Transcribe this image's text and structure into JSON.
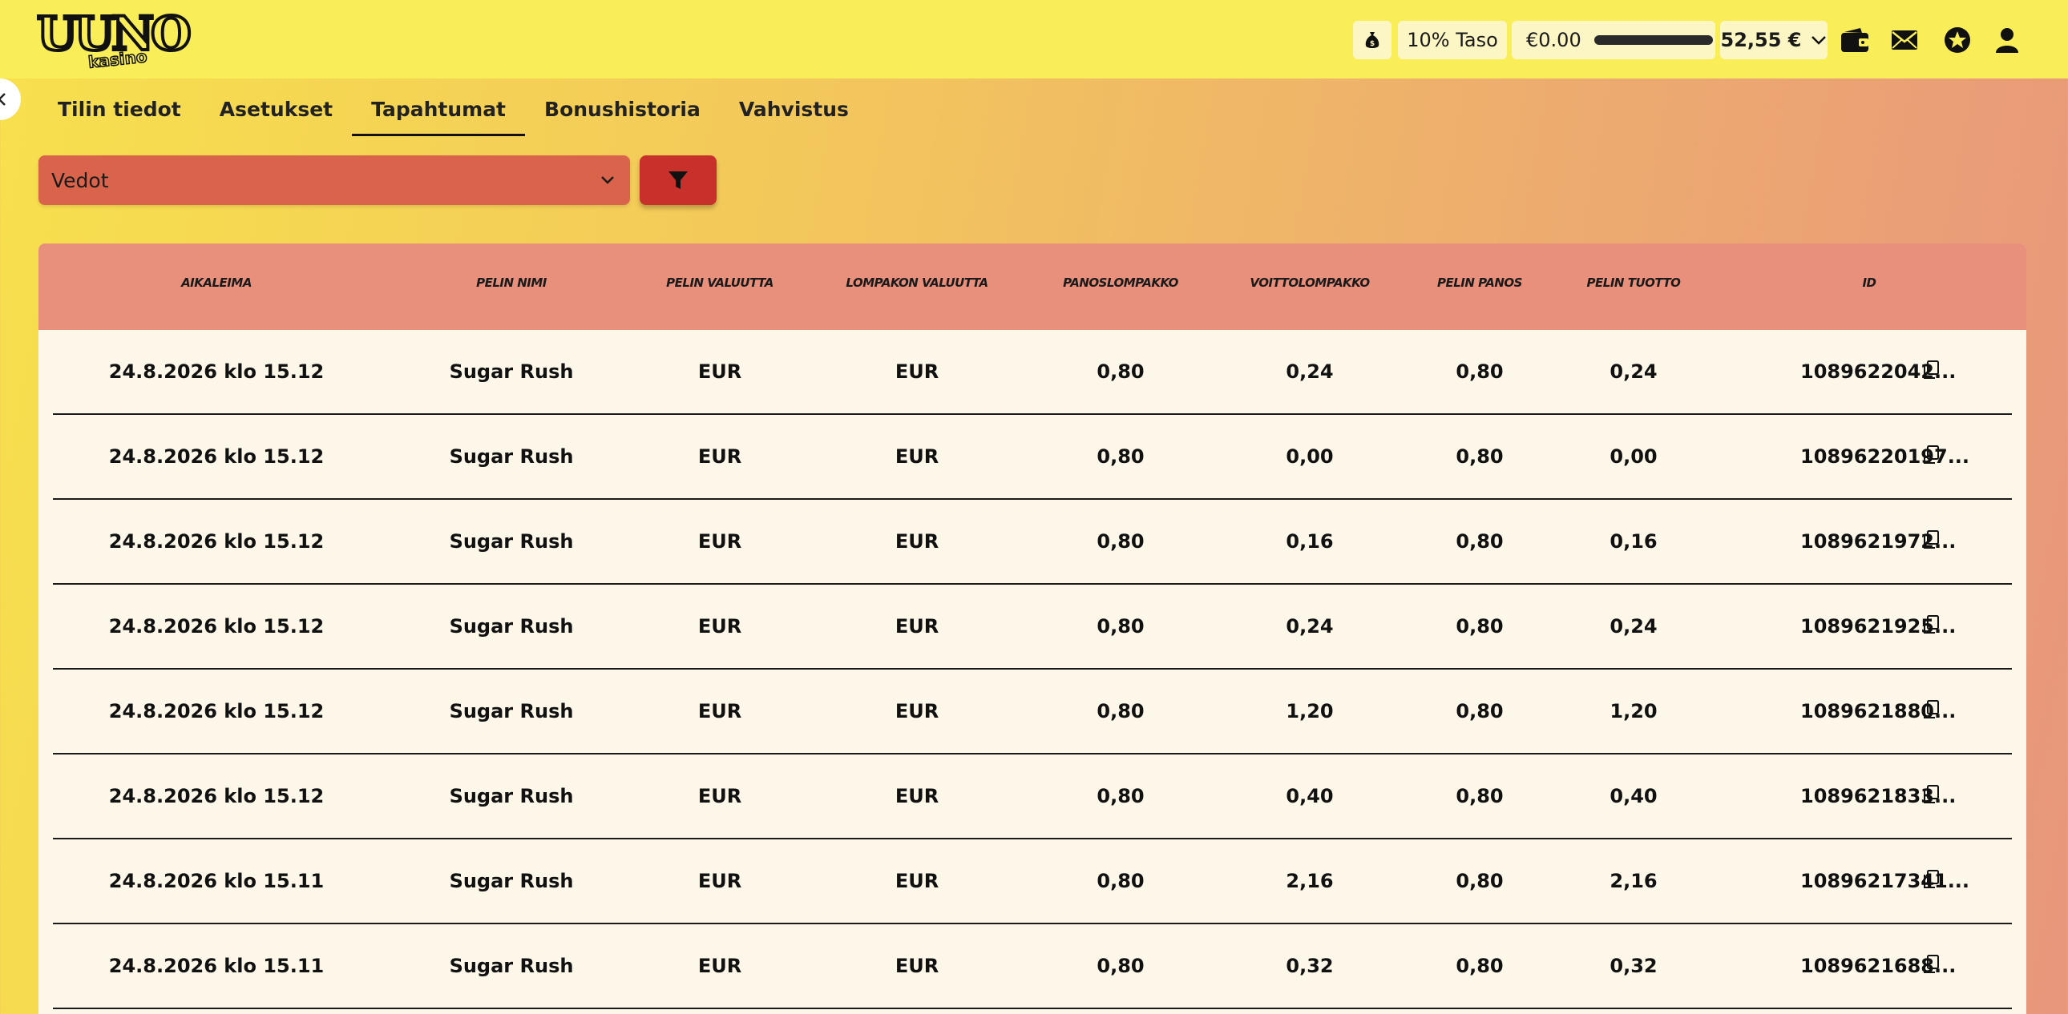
{
  "header": {
    "logo_main": "UUNO",
    "logo_sub": "kasino",
    "level_label": "10% Taso",
    "progress_amount": "€0.00",
    "progress_fraction": 0.0,
    "balance": "52,55 €",
    "icons": [
      "money-bag-icon",
      "wallet-icon",
      "mail-icon",
      "star-icon",
      "user-icon"
    ]
  },
  "tabs": [
    {
      "label": "Tilin tiedot",
      "active": false
    },
    {
      "label": "Asetukset",
      "active": false
    },
    {
      "label": "Tapahtumat",
      "active": true
    },
    {
      "label": "Bonushistoria",
      "active": false
    },
    {
      "label": "Vahvistus",
      "active": false
    }
  ],
  "filter": {
    "selected": "Vedot"
  },
  "table": {
    "columns": [
      "Aikaleima",
      "Pelin nimi",
      "Pelin valuutta",
      "Lompakon valuutta",
      "Panoslompakko",
      "Voittolompakko",
      "Pelin panos",
      "Pelin tuotto",
      "ID"
    ],
    "rows": [
      [
        "24.8.2026 klo 15.12",
        "Sugar Rush",
        "EUR",
        "EUR",
        "0,80",
        "0,24",
        "0,80",
        "0,24",
        "1089622042..."
      ],
      [
        "24.8.2026 klo 15.12",
        "Sugar Rush",
        "EUR",
        "EUR",
        "0,80",
        "0,00",
        "0,80",
        "0,00",
        "10896220197..."
      ],
      [
        "24.8.2026 klo 15.12",
        "Sugar Rush",
        "EUR",
        "EUR",
        "0,80",
        "0,16",
        "0,80",
        "0,16",
        "1089621972..."
      ],
      [
        "24.8.2026 klo 15.12",
        "Sugar Rush",
        "EUR",
        "EUR",
        "0,80",
        "0,24",
        "0,80",
        "0,24",
        "1089621925..."
      ],
      [
        "24.8.2026 klo 15.12",
        "Sugar Rush",
        "EUR",
        "EUR",
        "0,80",
        "1,20",
        "0,80",
        "1,20",
        "1089621880..."
      ],
      [
        "24.8.2026 klo 15.12",
        "Sugar Rush",
        "EUR",
        "EUR",
        "0,80",
        "0,40",
        "0,80",
        "0,40",
        "1089621833..."
      ],
      [
        "24.8.2026 klo 15.11",
        "Sugar Rush",
        "EUR",
        "EUR",
        "0,80",
        "2,16",
        "0,80",
        "2,16",
        "10896217341..."
      ],
      [
        "24.8.2026 klo 15.11",
        "Sugar Rush",
        "EUR",
        "EUR",
        "0,80",
        "0,32",
        "0,80",
        "0,32",
        "1089621688..."
      ]
    ]
  }
}
